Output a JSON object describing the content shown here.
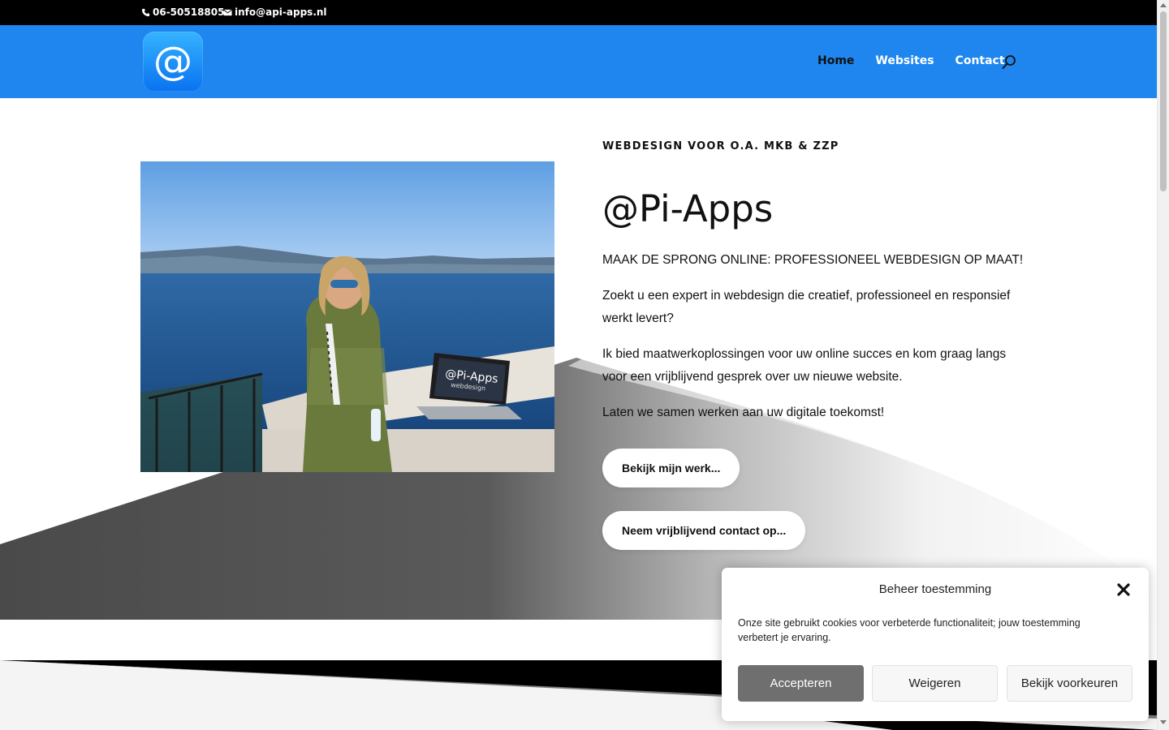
{
  "topbar": {
    "phone": "06-50518805",
    "email": "info@api-apps.nl"
  },
  "header": {
    "logo_glyph": "@",
    "nav": [
      {
        "label": "Home",
        "active": true
      },
      {
        "label": "Websites",
        "active": false
      },
      {
        "label": "Contact",
        "active": false
      }
    ]
  },
  "hero": {
    "kicker": "WEBDESIGN VOOR O.A. MKB & ZZP",
    "title": "@Pi-Apps",
    "subtitle": "MAAK DE SPRONG ONLINE: PROFESSIONEEL WEBDESIGN OP MAAT!",
    "paragraphs": [
      "Zoekt u een expert in webdesign die creatief, professioneel en responsief werkt levert?",
      "Ik bied maatwerkoplossingen voor uw online succes en kom graag langs voor een vrijblijvend gesprek over uw nieuwe website.",
      "Laten we samen werken aan uw digitale toekomst!"
    ],
    "buttons": [
      "Bekijk mijn werk...",
      "Neem vrijblijvend contact op..."
    ],
    "photo_laptop_title": "@Pi-Apps",
    "photo_laptop_subtitle": "webdesign"
  },
  "cookie": {
    "title": "Beheer toestemming",
    "text": "Onze site gebruikt cookies voor verbeterde functionaliteit; jouw toestemming verbetert je ervaring.",
    "accept": "Accepteren",
    "deny": "Weigeren",
    "preferences": "Bekijk voorkeuren"
  },
  "colors": {
    "brand_blue": "#1f86ef",
    "topbar": "#000000",
    "accept_button": "#6f6f6f"
  },
  "icons": [
    "phone-icon",
    "mail-icon",
    "search-icon",
    "close-icon"
  ]
}
